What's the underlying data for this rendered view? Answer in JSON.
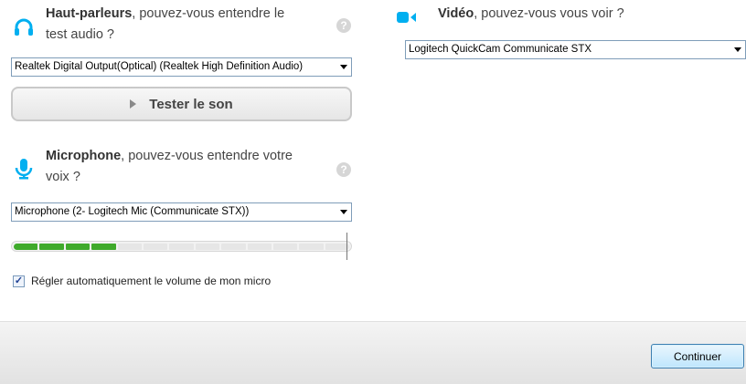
{
  "speakers": {
    "title_bold": "Haut-parleurs",
    "title_rest": ", pouvez-vous entendre le",
    "title_line2": "test audio ?",
    "icon": "headphones-icon",
    "device": "Realtek Digital Output(Optical) (Realtek High Definition Audio)",
    "test_button": "Tester le son"
  },
  "microphone": {
    "title_bold": "Microphone",
    "title_rest": ", pouvez-vous entendre votre",
    "title_line2": "voix ?",
    "icon": "microphone-icon",
    "device": "Microphone (2- Logitech Mic (Communicate STX))",
    "level_fraction": 0.31,
    "auto_volume_label": "Régler automatiquement le volume de mon micro",
    "auto_volume_checked": true
  },
  "video": {
    "title_bold": "Vidéo",
    "title_rest": ", pouvez-vous vous voir ?",
    "icon": "video-camera-icon",
    "device": "Logitech QuickCam Communicate STX"
  },
  "help_symbol": "?",
  "checkmark": "✓",
  "footer": {
    "continue_label": "Continuer"
  },
  "colors": {
    "accent": "#00aff0",
    "meter_active": "#3faa2b"
  }
}
